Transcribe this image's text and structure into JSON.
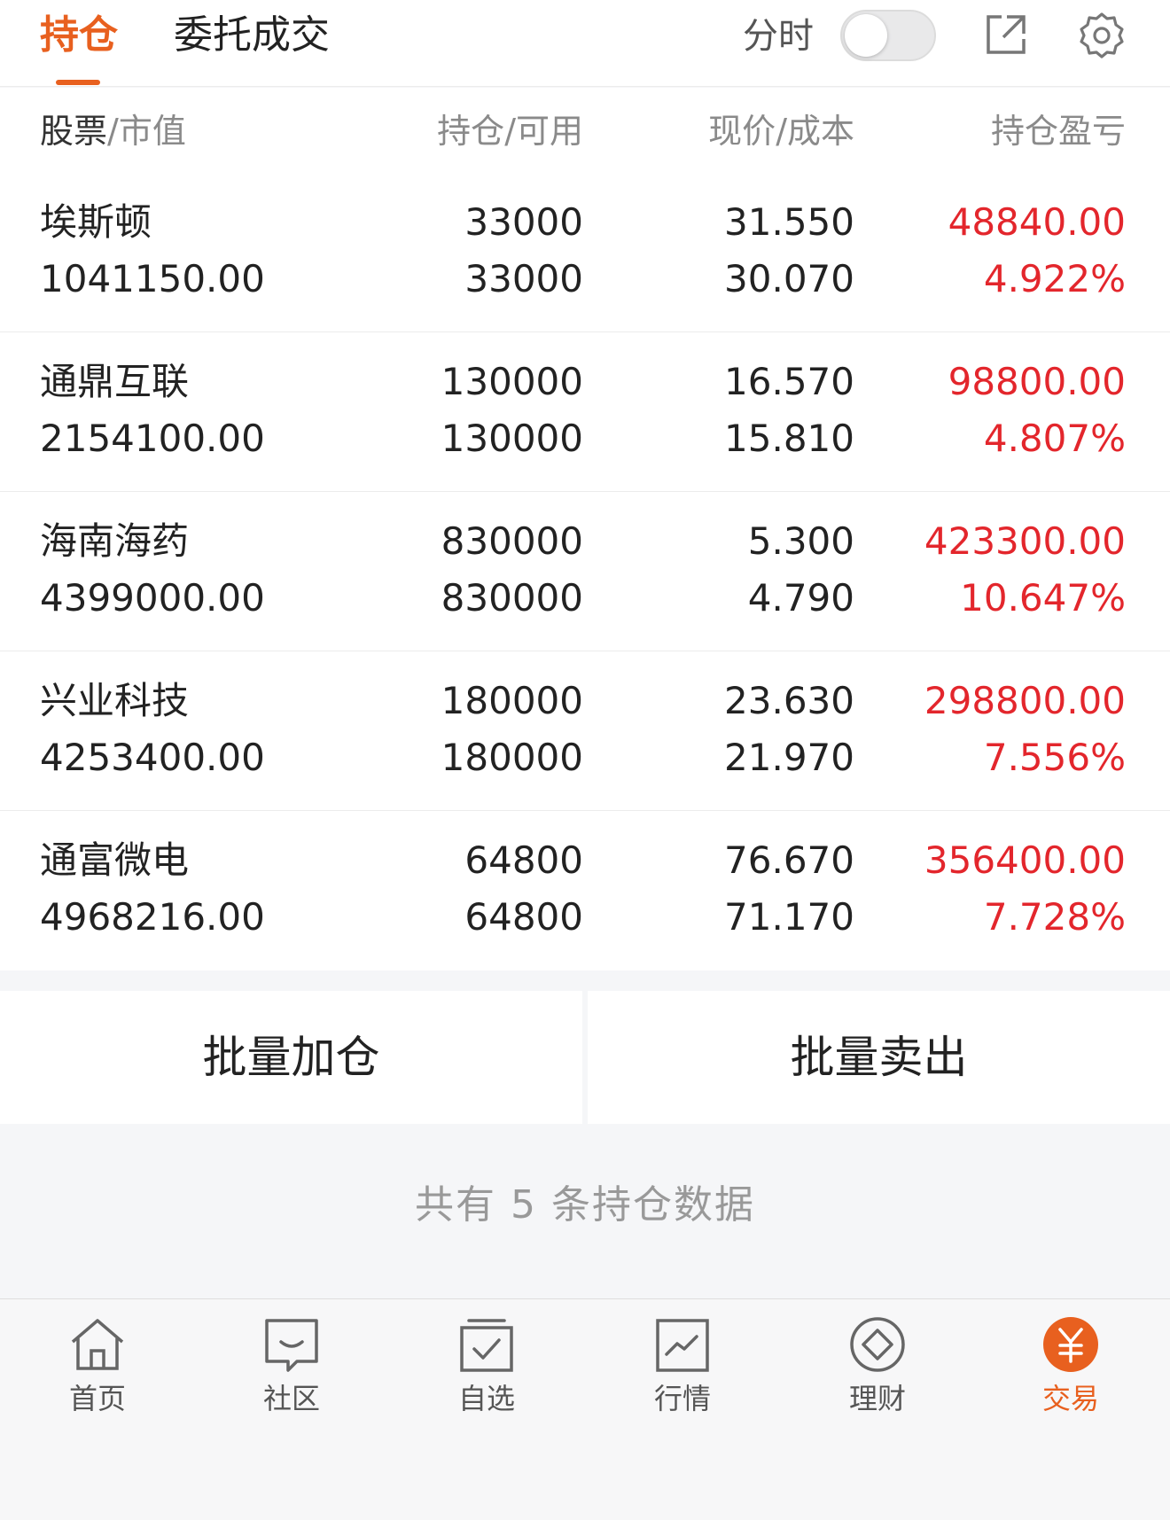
{
  "header": {
    "tabs": [
      {
        "label": "持仓",
        "active": true
      },
      {
        "label": "委托成交",
        "active": false
      }
    ],
    "fenshi_label": "分时",
    "fenshi_toggle_on": false,
    "icons": [
      "share-icon",
      "gear-icon"
    ]
  },
  "columns": {
    "stock": "股票",
    "market_value": "/市值",
    "position": "持仓",
    "available": "/可用",
    "price": "现价",
    "cost": "/成本",
    "pnl": "持仓盈亏"
  },
  "holdings": [
    {
      "name": "埃斯顿",
      "market_value": "1041150.00",
      "position": "33000",
      "available": "33000",
      "price": "31.550",
      "cost": "30.070",
      "pnl": "48840.00",
      "pnl_pct": "4.922%"
    },
    {
      "name": "通鼎互联",
      "market_value": "2154100.00",
      "position": "130000",
      "available": "130000",
      "price": "16.570",
      "cost": "15.810",
      "pnl": "98800.00",
      "pnl_pct": "4.807%"
    },
    {
      "name": "海南海药",
      "market_value": "4399000.00",
      "position": "830000",
      "available": "830000",
      "price": "5.300",
      "cost": "4.790",
      "pnl": "423300.00",
      "pnl_pct": "10.647%"
    },
    {
      "name": "兴业科技",
      "market_value": "4253400.00",
      "position": "180000",
      "available": "180000",
      "price": "23.630",
      "cost": "21.970",
      "pnl": "298800.00",
      "pnl_pct": "7.556%"
    },
    {
      "name": "通富微电",
      "market_value": "4968216.00",
      "position": "64800",
      "available": "64800",
      "price": "76.670",
      "cost": "71.170",
      "pnl": "356400.00",
      "pnl_pct": "7.728%"
    }
  ],
  "actions": {
    "batch_add": "批量加仓",
    "batch_sell": "批量卖出"
  },
  "summary": "共有 5 条持仓数据",
  "nav": [
    {
      "label": "首页",
      "icon": "home-icon",
      "active": false
    },
    {
      "label": "社区",
      "icon": "chat-icon",
      "active": false
    },
    {
      "label": "自选",
      "icon": "checkbox-icon",
      "active": false
    },
    {
      "label": "行情",
      "icon": "chart-icon",
      "active": false
    },
    {
      "label": "理财",
      "icon": "diamond-icon",
      "active": false
    },
    {
      "label": "交易",
      "icon": "yen-icon",
      "active": true
    }
  ],
  "colors": {
    "accent": "#e8601f",
    "profit": "#e3262c"
  }
}
